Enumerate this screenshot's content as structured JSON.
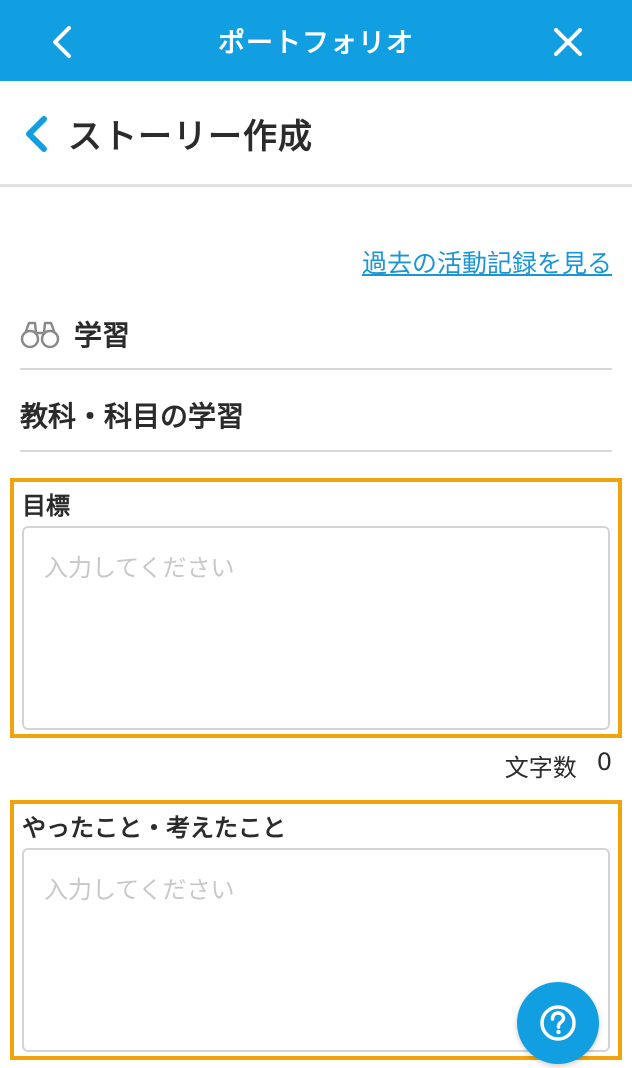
{
  "topbar": {
    "title": "ポートフォリオ",
    "back_icon": "chevron-left-icon",
    "close_icon": "close-icon"
  },
  "header": {
    "title": "ストーリー作成",
    "back_icon": "chevron-left-icon"
  },
  "history_link": "過去の活動記録を見る",
  "category": {
    "icon": "binoculars-icon",
    "label": "学習"
  },
  "subject": "教科・科目の学習",
  "goal_field": {
    "label": "目標",
    "value": "",
    "placeholder": "入力してください"
  },
  "char_count": {
    "label": "文字数",
    "value": "0"
  },
  "reflection_field": {
    "label": "やったこと・考えたこと",
    "value": "",
    "placeholder": "入力してください"
  },
  "help_button": {
    "icon": "question-icon"
  },
  "colors": {
    "brand_blue": "#129fe1",
    "link_blue": "#1a96d6",
    "highlight_orange": "#f0a30a"
  }
}
